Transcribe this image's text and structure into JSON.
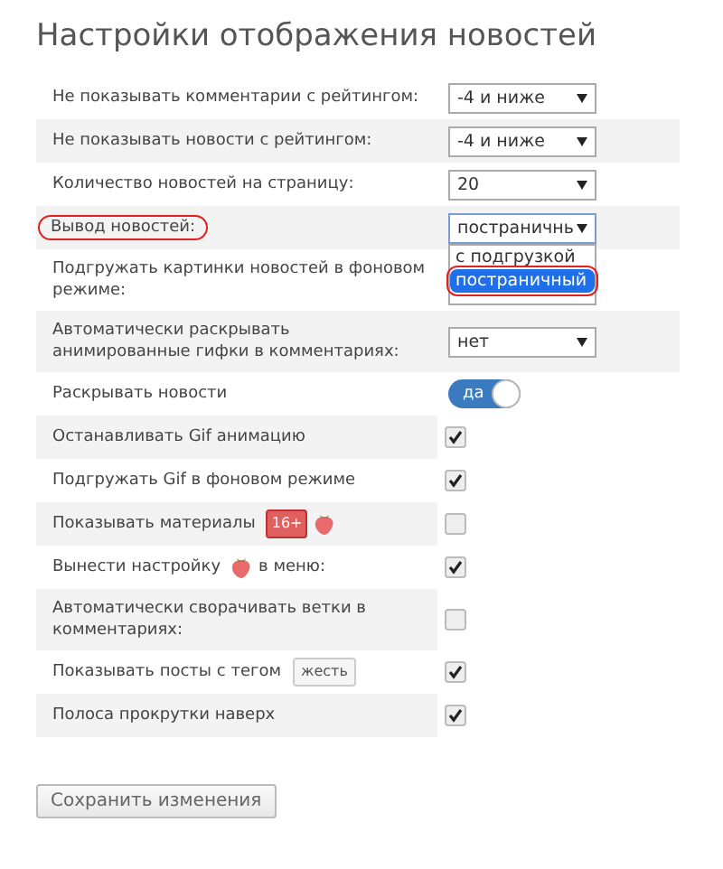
{
  "title": "Настройки отображения новостей",
  "rows": [
    {
      "label": [
        {
          "kind": "text",
          "text": "Не показывать комментарии с рейтингом:"
        }
      ],
      "control": {
        "kind": "select",
        "value": "-4 и ниже"
      }
    },
    {
      "label": [
        {
          "kind": "text",
          "text": "Не показывать новости с рейтингом:"
        }
      ],
      "control": {
        "kind": "select",
        "value": "-4 и ниже"
      }
    },
    {
      "label": [
        {
          "kind": "text",
          "text": "Количество новостей на страницу:"
        }
      ],
      "control": {
        "kind": "select",
        "value": "20"
      }
    },
    {
      "label": [
        {
          "kind": "text",
          "text": "Вывод новостей:"
        }
      ],
      "highlighted": true,
      "control": {
        "kind": "select",
        "value": "постраничнь",
        "open": true,
        "options": [
          {
            "text": "с подгрузкой",
            "selected": false,
            "highlighted": false
          },
          {
            "text": "постраничный",
            "selected": true,
            "highlighted": true
          }
        ]
      }
    },
    {
      "label": [
        {
          "kind": "text",
          "text": "Подгружать картинки новостей в фоновом режиме:"
        }
      ],
      "control": {
        "kind": "hidden"
      }
    },
    {
      "label": [
        {
          "kind": "text",
          "text": "Автоматически раскрывать анимированные гифки в комментариях:"
        }
      ],
      "control": {
        "kind": "select",
        "value": "нет"
      }
    },
    {
      "label": [
        {
          "kind": "text",
          "text": "Раскрывать новости"
        }
      ],
      "control": {
        "kind": "toggle",
        "text": "да",
        "on": true
      }
    },
    {
      "label": [
        {
          "kind": "text",
          "text": "Останавливать Gif анимацию"
        }
      ],
      "control": {
        "kind": "checkbox",
        "checked": true
      }
    },
    {
      "label": [
        {
          "kind": "text",
          "text": "Подгружать Gif в фоновом режиме"
        }
      ],
      "control": {
        "kind": "checkbox",
        "checked": true
      }
    },
    {
      "label": [
        {
          "kind": "text",
          "text": "Показывать материалы"
        },
        {
          "kind": "badge",
          "text": "16+"
        },
        {
          "kind": "strawberry"
        }
      ],
      "control": {
        "kind": "checkbox",
        "checked": false
      }
    },
    {
      "label": [
        {
          "kind": "text",
          "text": "Вынести настройку"
        },
        {
          "kind": "strawberry"
        },
        {
          "kind": "text",
          "text": "в меню:"
        }
      ],
      "control": {
        "kind": "checkbox",
        "checked": true
      }
    },
    {
      "label": [
        {
          "kind": "text",
          "text": "Автоматически сворачивать ветки в комментариях:"
        }
      ],
      "control": {
        "kind": "checkbox",
        "checked": false
      }
    },
    {
      "label": [
        {
          "kind": "text",
          "text": "Показывать посты с тегом"
        },
        {
          "kind": "tag",
          "text": "жесть"
        }
      ],
      "control": {
        "kind": "checkbox",
        "checked": true
      }
    },
    {
      "label": [
        {
          "kind": "text",
          "text": "Полоса прокрутки наверх"
        }
      ],
      "control": {
        "kind": "checkbox",
        "checked": true
      }
    }
  ],
  "save_button": "Сохранить изменения"
}
